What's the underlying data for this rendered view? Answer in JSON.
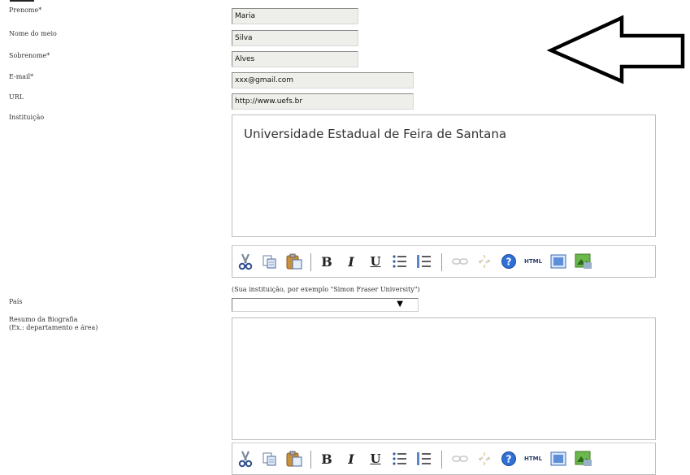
{
  "form": {
    "fields": [
      {
        "label": "Prenome*",
        "value": "Maria"
      },
      {
        "label": "Nome do meio",
        "value": "Silva"
      },
      {
        "label": "Sobrenome*",
        "value": "Alves"
      },
      {
        "label": "E-mail*",
        "value": "xxx@gmail.com"
      },
      {
        "label": "URL",
        "value": "http://www.uefs.br"
      }
    ],
    "institution": {
      "label": "Instituição",
      "content": "Universidade Estadual de Feira de Santana",
      "hint": "(Sua instituição, por exemplo \"Simon Fraser University\")"
    },
    "country": {
      "label": "País",
      "selected": "",
      "arrow": "▼"
    },
    "bio": {
      "label_line1": "Resumo da Biografia",
      "label_line2": "(Ex.: departamento e área)",
      "content": ""
    }
  },
  "toolbar": {
    "icons": [
      "cut-icon",
      "copy-icon",
      "paste-icon",
      "bold-icon",
      "italic-icon",
      "underline-icon",
      "bullet-list-icon",
      "numbered-list-icon",
      "link-icon",
      "unlink-icon",
      "help-icon",
      "html-icon",
      "fullscreen-icon",
      "image-icon"
    ],
    "bold": "B",
    "italic": "I",
    "underline": "U",
    "html": "HTML"
  },
  "annotation": {
    "shape": "arrow-left",
    "color": "#000000"
  }
}
